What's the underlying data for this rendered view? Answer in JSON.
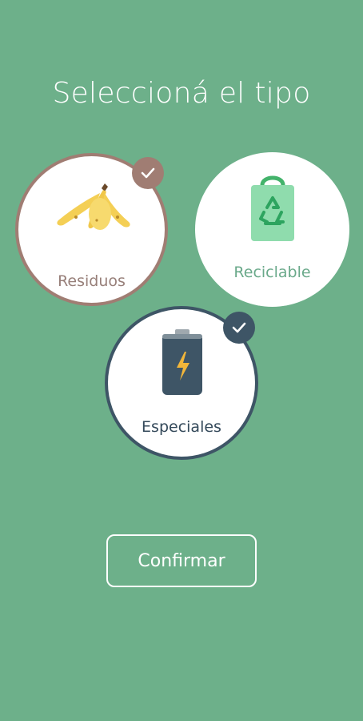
{
  "header": {
    "title": "Seleccioná el tipo"
  },
  "options": [
    {
      "label": "Residuos",
      "icon": "banana-peel-icon",
      "selected": true,
      "accent": "#a07d73"
    },
    {
      "label": "Reciclable",
      "icon": "recycle-bag-icon",
      "selected": false,
      "accent": "#6aa98a"
    },
    {
      "label": "Especiales",
      "icon": "battery-icon",
      "selected": true,
      "accent": "#3e5566"
    }
  ],
  "actions": {
    "confirm_label": "Confirmar"
  },
  "colors": {
    "background": "#6db08a",
    "white": "#ffffff"
  }
}
